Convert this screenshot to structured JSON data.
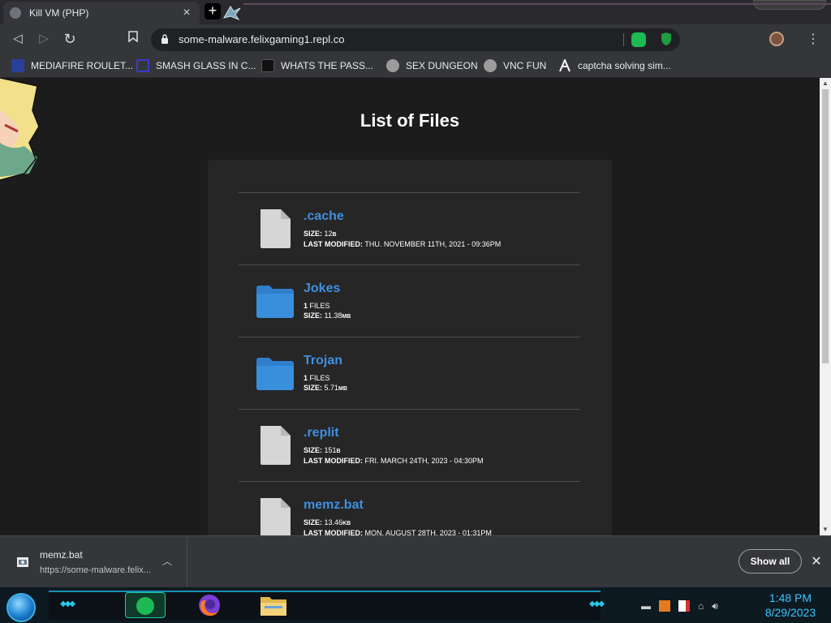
{
  "browser": {
    "tab_title": "Kill VM (PHP)",
    "tab_close": "×",
    "new_tab": "+",
    "url": "some-malware.felixgaming1.repl.co",
    "back": "◁",
    "forward": "▷",
    "reload": "↻",
    "bookmark_star": "🔖",
    "menu": "⋮"
  },
  "bookmarks": [
    {
      "label": "MEDIAFIRE ROULET...",
      "icon_color": "#2a3f9a"
    },
    {
      "label": "SMASH GLASS IN C...",
      "icon_color": "#3a3ad0"
    },
    {
      "label": "WHATS THE PASS...",
      "icon_color": "#111111"
    },
    {
      "label": "SEX DUNGEON",
      "icon_color": "#bbbbbb"
    },
    {
      "label": "VNC FUN",
      "icon_color": "#bbbbbb"
    },
    {
      "label": "captcha solving sim...",
      "icon_color": "#ffffff"
    }
  ],
  "page": {
    "title": "List of Files",
    "files": [
      {
        "name": ".cache",
        "type": "file",
        "line1_key": "SIZE:",
        "line1_val": " 12",
        "line1_unit": "B",
        "line2_key": "LAST MODIFIED:",
        "line2_val": " THU. NOVEMBER 11TH, 2021 - 09:36PM",
        "line2_unit": ""
      },
      {
        "name": "Jokes",
        "type": "folder",
        "line1_key": "1",
        "line1_val": " FILES",
        "line1_unit": "",
        "line2_key": "SIZE:",
        "line2_val": " 11.38",
        "line2_unit": "MB"
      },
      {
        "name": "Trojan",
        "type": "folder",
        "line1_key": "1",
        "line1_val": " FILES",
        "line1_unit": "",
        "line2_key": "SIZE:",
        "line2_val": " 5.71",
        "line2_unit": "MB"
      },
      {
        "name": ".replit",
        "type": "file",
        "line1_key": "SIZE:",
        "line1_val": " 151",
        "line1_unit": "B",
        "line2_key": "LAST MODIFIED:",
        "line2_val": " FRI. MARCH 24TH, 2023 - 04:30PM",
        "line2_unit": ""
      },
      {
        "name": "memz.bat",
        "type": "file",
        "line1_key": "SIZE:",
        "line1_val": " 13.46",
        "line1_unit": "KB",
        "line2_key": "LAST MODIFIED:",
        "line2_val": " MON. AUGUST 28TH, 2023 - 01:31PM",
        "line2_unit": ""
      }
    ]
  },
  "downloads": {
    "file_name": "memz.bat",
    "file_url": "https://some-malware.felix...",
    "show_all": "Show all",
    "close": "✕",
    "chevron": "︿"
  },
  "taskbar": {
    "time": "1:48 PM",
    "date": "8/29/2023"
  },
  "colors": {
    "link": "#3f8fe0",
    "folder": "#3a8fdc",
    "file": "#d6d6d6",
    "clock": "#39c6ff"
  }
}
